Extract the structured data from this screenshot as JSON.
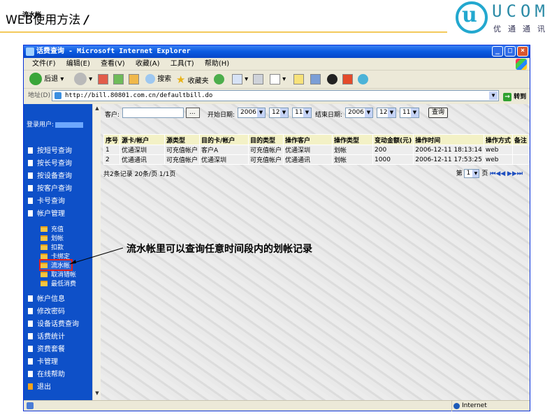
{
  "slide": {
    "title_main": "WEB使用方法",
    "title_sep": "/",
    "title_sub": "流水帐",
    "logo_text": "UCOM",
    "logo_sub": "优通通讯"
  },
  "window": {
    "title": "话费查询 - Microsoft Internet Explorer",
    "menus": [
      "文件(F)",
      "编辑(E)",
      "查看(V)",
      "收藏(A)",
      "工具(T)",
      "帮助(H)"
    ],
    "toolbar": {
      "back": "后退",
      "search": "搜索",
      "favorites": "收藏夹"
    },
    "address_label": "地址(D)",
    "address_url": "http://bill.80801.com.cn/defaultbill.do",
    "go": "转到",
    "status_zone": "Internet"
  },
  "sidebar": {
    "user_label": "登录用户:",
    "items": [
      "按短号查询",
      "按长号查询",
      "按设备查询",
      "按客户查询",
      "卡号查询",
      "帐户管理"
    ],
    "sub_items": [
      "充值",
      "划帐",
      "扣款",
      "卡绑定",
      "流水帐",
      "取消错帐",
      "最低消费"
    ],
    "items_bottom": [
      "帐户信息",
      "修改密码",
      "设备话费查询",
      "话费统计",
      "资费套餐",
      "卡管理",
      "在线帮助",
      "退出"
    ]
  },
  "filters": {
    "customer_label": "客户:",
    "browse": "...",
    "start_label": "开始日期:",
    "start": {
      "year": "2006",
      "month": "12",
      "day": "11"
    },
    "end_label": "结束日期:",
    "end": {
      "year": "2006",
      "month": "12",
      "day": "11"
    },
    "search_button": "查询"
  },
  "table": {
    "headers": [
      "序号",
      "源卡/帐户",
      "源类型",
      "目的卡/帐户",
      "目的类型",
      "操作客户",
      "操作类型",
      "变动金额(元)",
      "操作时间",
      "操作方式",
      "备注"
    ],
    "rows": [
      [
        "1",
        "优通深圳",
        "可充值帐户",
        "客户A",
        "可充值帐户",
        "优通深圳",
        "划帐",
        "200",
        "2006-12-11 18:13:14",
        "web",
        ""
      ],
      [
        "2",
        "优通通讯",
        "可充值帐户",
        "优通深圳",
        "可充值帐户",
        "优通通讯",
        "划帐",
        "1000",
        "2006-12-11 17:53:25",
        "web",
        ""
      ]
    ]
  },
  "summary": "共2条记录 20条/页 1/1页",
  "pager": {
    "prefix": "第",
    "current": "1",
    "suffix": "页"
  },
  "annotation": "流水帐里可以查询任意时间段内的划帐记录",
  "colors": {
    "sidebar": "#0e50c8",
    "highlight": "#e02020",
    "header_rule": "#f3c95a",
    "brand": "#23a8cf"
  }
}
